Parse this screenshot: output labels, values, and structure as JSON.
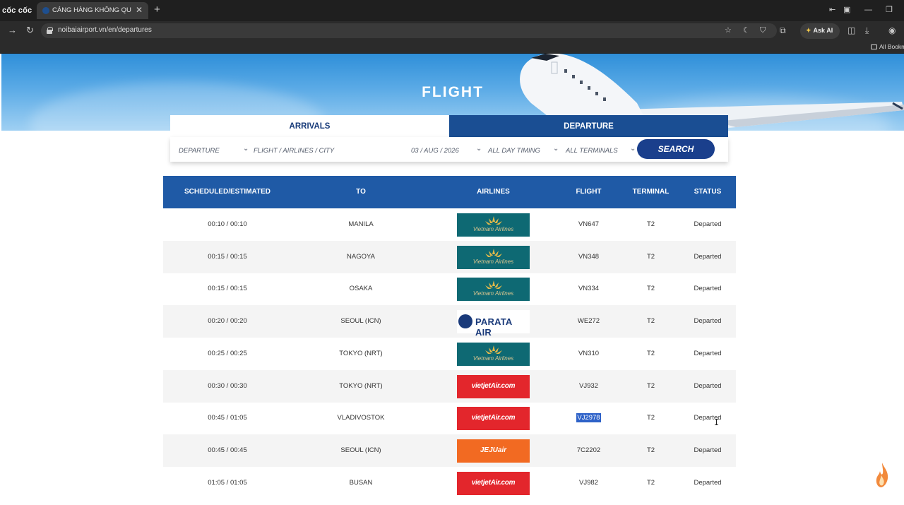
{
  "browser": {
    "brand": "cốc cốc",
    "tab_title": "CẢNG HÀNG KHÔNG QUỐ",
    "url": "noibaiairport.vn/en/departures",
    "ask_ai": "Ask AI",
    "bookmarks_folder": "All Bookm"
  },
  "hero": {
    "title": "FLIGHT"
  },
  "tabs": {
    "arrivals": "ARRIVALS",
    "departure": "DEPARTURE"
  },
  "filters": {
    "type": "DEPARTURE",
    "query_placeholder": "FLIGHT / AIRLINES / CITY",
    "date": "03 / AUG / 2026",
    "timing": "ALL DAY TIMING",
    "terminals": "ALL TERMINALS",
    "search": "SEARCH"
  },
  "table": {
    "headers": {
      "scheduled": "SCHEDULED/ESTIMATED",
      "to": "TO",
      "airlines": "AIRLINES",
      "flight": "FLIGHT",
      "terminal": "TERMINAL",
      "status": "STATUS"
    },
    "rows": [
      {
        "time": "00:10 / 00:10",
        "to": "MANILA",
        "airline": "Vietnam Airlines",
        "logo": "vietnam-airlines",
        "flight": "VN647",
        "terminal": "T2",
        "status": "Departed"
      },
      {
        "time": "00:15 / 00:15",
        "to": "NAGOYA",
        "airline": "Vietnam Airlines",
        "logo": "vietnam-airlines",
        "flight": "VN348",
        "terminal": "T2",
        "status": "Departed"
      },
      {
        "time": "00:15 / 00:15",
        "to": "OSAKA",
        "airline": "Vietnam Airlines",
        "logo": "vietnam-airlines",
        "flight": "VN334",
        "terminal": "T2",
        "status": "Departed"
      },
      {
        "time": "00:20 / 00:20",
        "to": "SEOUL (ICN)",
        "airline": "PARATA AIR",
        "logo": "parata-air",
        "flight": "WE272",
        "terminal": "T2",
        "status": "Departed"
      },
      {
        "time": "00:25 / 00:25",
        "to": "TOKYO (NRT)",
        "airline": "Vietnam Airlines",
        "logo": "vietnam-airlines",
        "flight": "VN310",
        "terminal": "T2",
        "status": "Departed"
      },
      {
        "time": "00:30 / 00:30",
        "to": "TOKYO (NRT)",
        "airline": "vietjetAir.com",
        "logo": "vietjet",
        "flight": "VJ932",
        "terminal": "T2",
        "status": "Departed"
      },
      {
        "time": "00:45 / 01:05",
        "to": "VLADIVOSTOK",
        "airline": "vietjetAir.com",
        "logo": "vietjet",
        "flight": "VJ2978",
        "terminal": "T2",
        "status": "Departed"
      },
      {
        "time": "00:45 / 00:45",
        "to": "SEOUL (ICN)",
        "airline": "JEJUair",
        "logo": "jeju-air",
        "flight": "7C2202",
        "terminal": "T2",
        "status": "Departed"
      },
      {
        "time": "01:05 / 01:05",
        "to": "BUSAN",
        "airline": "vietjetAir.com",
        "logo": "vietjet",
        "flight": "VJ982",
        "terminal": "T2",
        "status": "Departed"
      }
    ]
  },
  "colors": {
    "header_blue": "#1f5aa6",
    "departure_tab": "#1a4e93",
    "search_button": "#1a3f8c",
    "vietnam_airlines": "#0e6973",
    "vietjet": "#e3262c",
    "jeju_air": "#f26a22",
    "selection": "#2e62c8"
  }
}
